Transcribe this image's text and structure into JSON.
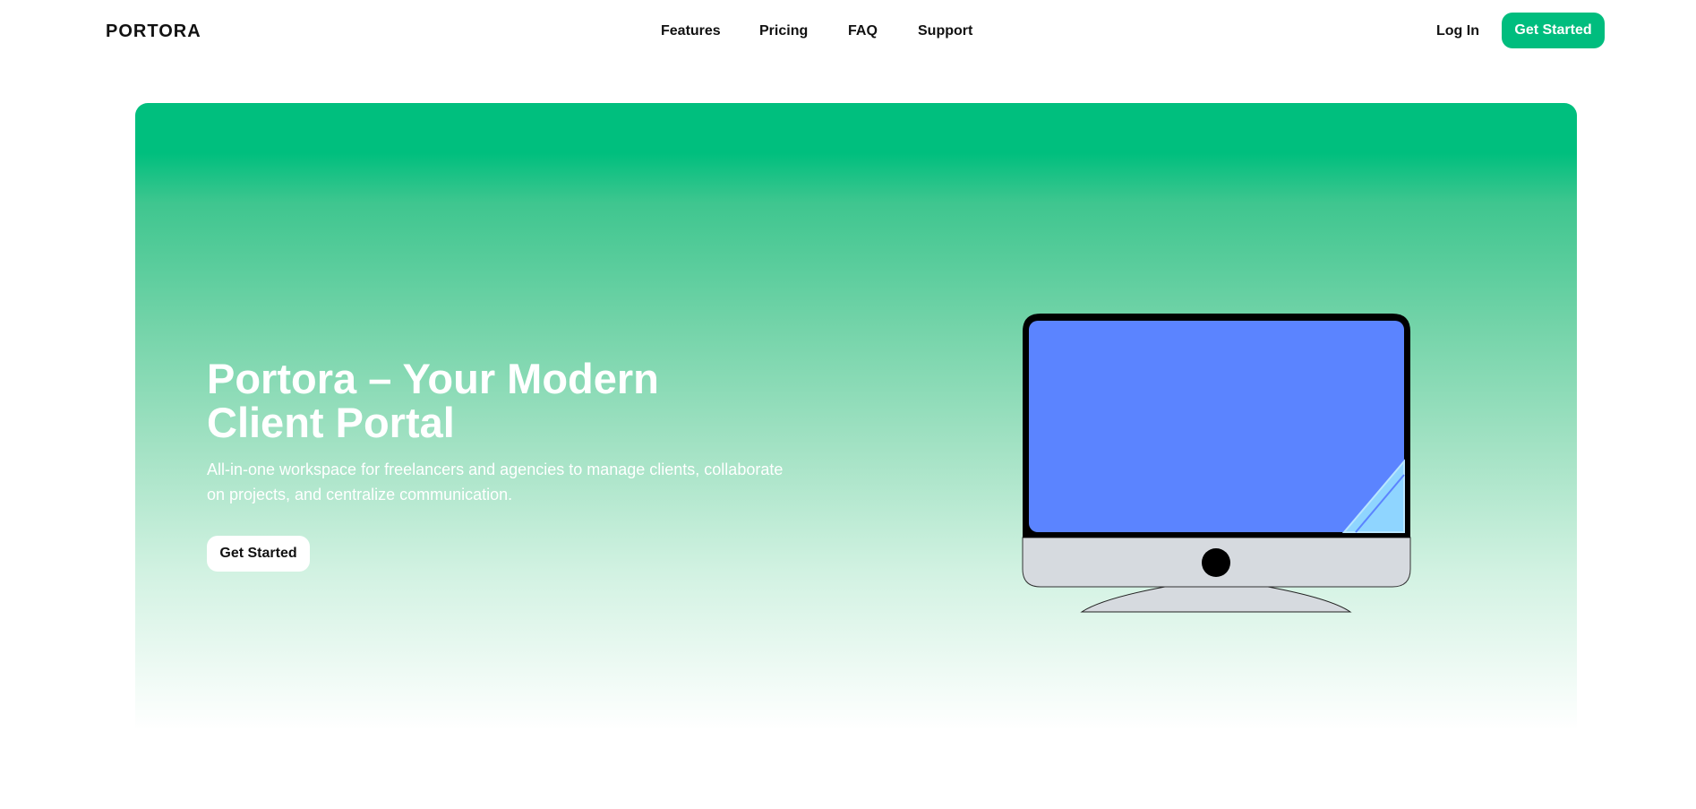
{
  "header": {
    "logo": "PORTORA",
    "nav": {
      "features": "Features",
      "pricing": "Pricing",
      "faq": "FAQ",
      "support": "Support"
    },
    "login_label": "Log In",
    "cta_label": "Get Started"
  },
  "hero": {
    "title_line1": "Portora – Your Modern",
    "title_line2": "Client Portal",
    "subtitle": "All-in-one workspace for freelancers and agencies to manage clients, collaborate on projects, and centralize communication.",
    "cta_label": "Get Started"
  },
  "colors": {
    "accent": "#00bd7e",
    "screen": "#5b84ff",
    "screen_corner": "#8fd5ff",
    "monitor_base": "#d6dadf"
  },
  "icons": {
    "illustration": "desktop-monitor-illustration"
  }
}
